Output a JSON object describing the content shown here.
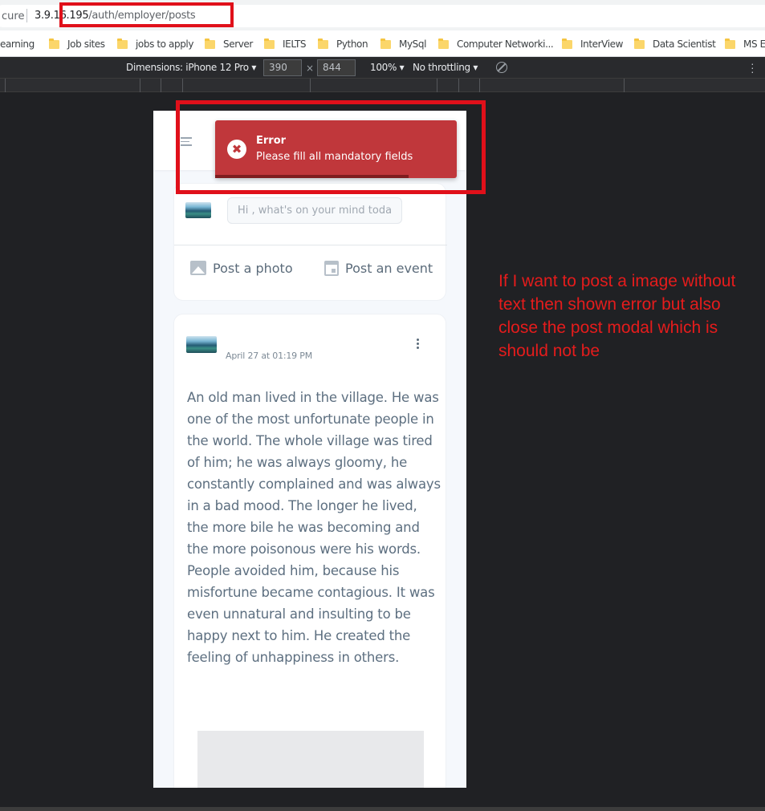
{
  "browser": {
    "security_label": "cure",
    "url_host": "3.9.16.195",
    "url_path": "/auth/employer/posts"
  },
  "bookmarks": [
    {
      "label": "earning",
      "folder": false
    },
    {
      "label": "Job sites",
      "folder": true
    },
    {
      "label": "jobs to apply",
      "folder": true
    },
    {
      "label": "Server",
      "folder": true
    },
    {
      "label": "IELTS",
      "folder": true
    },
    {
      "label": "Python",
      "folder": true
    },
    {
      "label": "MySql",
      "folder": true
    },
    {
      "label": "Computer Networki...",
      "folder": true
    },
    {
      "label": "InterView",
      "folder": true
    },
    {
      "label": "Data Scientist",
      "folder": true
    },
    {
      "label": "MS E",
      "folder": true
    }
  ],
  "device_toolbar": {
    "dimensions_label": "Dimensions: iPhone 12 Pro ▾",
    "width": "390",
    "times": "×",
    "height": "844",
    "zoom": "100% ▾",
    "throttling": "No throttling ▾"
  },
  "compose": {
    "placeholder": "Hi , what's on your mind toda",
    "post_photo": "Post a photo",
    "post_event": "Post an event"
  },
  "post": {
    "date": "April 27 at 01:19 PM",
    "body": "An old man lived in the village. He was one of the most unfortunate people in the world. The whole village was tired of him; he was always gloomy, he constantly complained and was always in a bad mood. The longer he lived, the more bile he was becoming and the more poisonous were his words. People avoided him, because his misfortune became contagious. It was even unnatural and insulting to be happy next to him. He created the feeling of unhappiness in others."
  },
  "toast": {
    "icon": "✖",
    "title": "Error",
    "message": "Please fill all mandatory fields"
  },
  "annotation": {
    "note": "If I want to post a image without text then shown error but also close the post modal which is should not be"
  },
  "colors": {
    "annotation_red": "#e0101a",
    "toast_red": "#c0373b"
  }
}
